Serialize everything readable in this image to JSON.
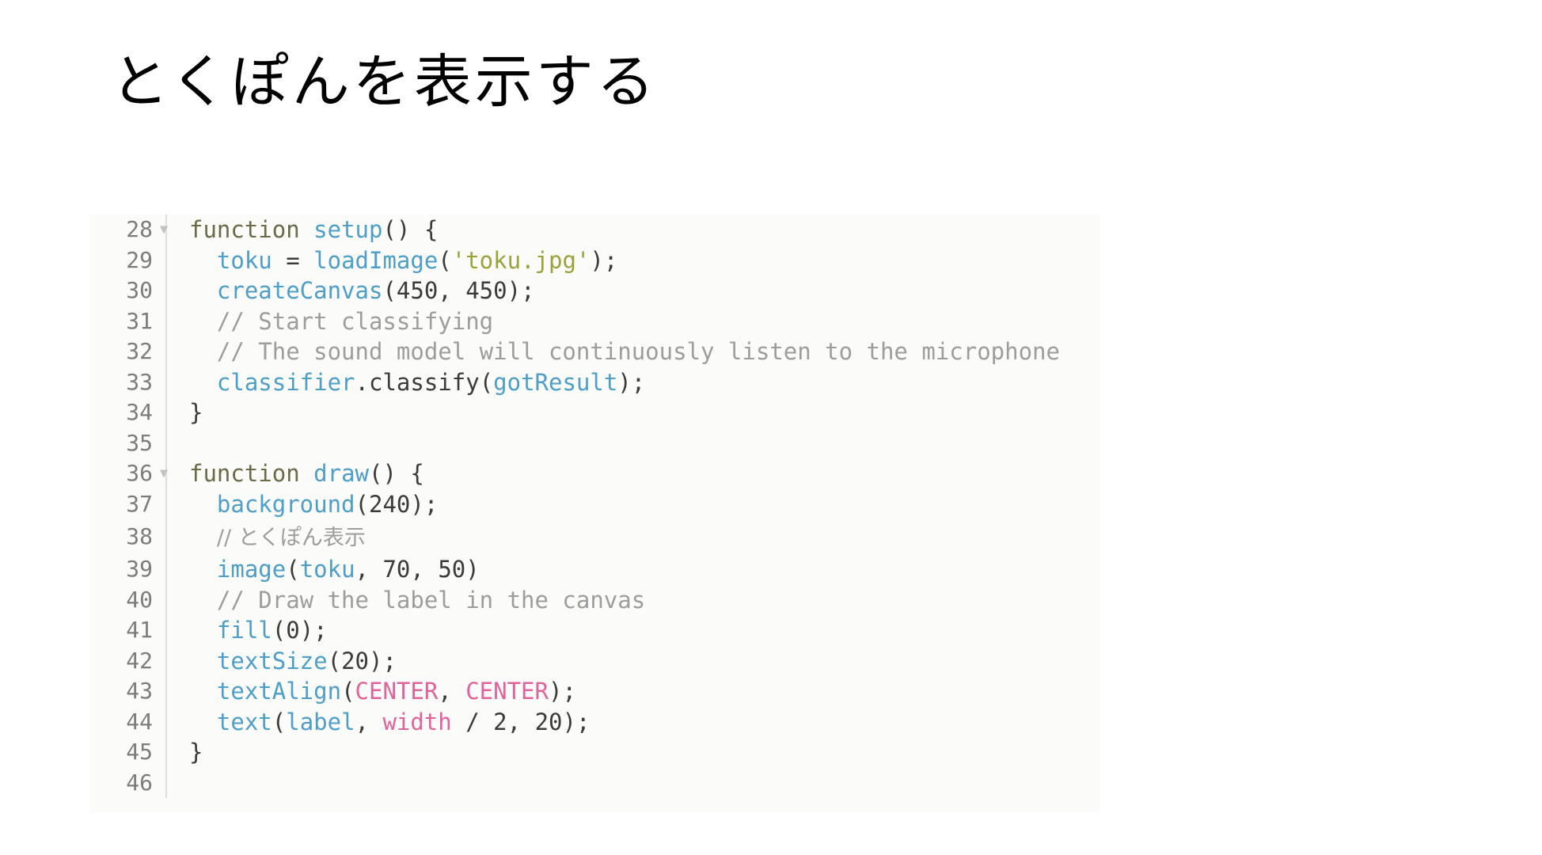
{
  "slide": {
    "title": "とくぽんを表示する",
    "background_color": "#ffffff",
    "title_color": "#000000"
  },
  "code_panel": {
    "background_color": "#fbfbfa",
    "gutter_color": "#7d7d7d",
    "language": "javascript",
    "fold_marker": "▼",
    "syntax_colors": {
      "keyword": "#6b6b47",
      "function": "#4d9ec9",
      "string": "#9aa33a",
      "comment": "#9d9d9d",
      "constant": "#e0649a",
      "plain": "#3b3b38"
    },
    "lines": [
      {
        "number": "28",
        "fold": "▼",
        "tokens": [
          {
            "t": "function",
            "c": "tok-kw"
          },
          {
            "t": " ",
            "c": "tok-plain"
          },
          {
            "t": "setup",
            "c": "tok-fn"
          },
          {
            "t": "() {",
            "c": "tok-punct"
          }
        ]
      },
      {
        "number": "29",
        "fold": "",
        "tokens": [
          {
            "t": "  ",
            "c": "tok-plain"
          },
          {
            "t": "toku",
            "c": "tok-var"
          },
          {
            "t": " = ",
            "c": "tok-punct"
          },
          {
            "t": "loadImage",
            "c": "tok-builtin"
          },
          {
            "t": "(",
            "c": "tok-punct"
          },
          {
            "t": "'toku.jpg'",
            "c": "tok-str"
          },
          {
            "t": ");",
            "c": "tok-punct"
          }
        ]
      },
      {
        "number": "30",
        "fold": "",
        "tokens": [
          {
            "t": "  ",
            "c": "tok-plain"
          },
          {
            "t": "createCanvas",
            "c": "tok-builtin"
          },
          {
            "t": "(",
            "c": "tok-punct"
          },
          {
            "t": "450",
            "c": "tok-num"
          },
          {
            "t": ", ",
            "c": "tok-punct"
          },
          {
            "t": "450",
            "c": "tok-num"
          },
          {
            "t": ");",
            "c": "tok-punct"
          }
        ]
      },
      {
        "number": "31",
        "fold": "",
        "tokens": [
          {
            "t": "  ",
            "c": "tok-plain"
          },
          {
            "t": "// Start classifying",
            "c": "tok-comment"
          }
        ]
      },
      {
        "number": "32",
        "fold": "",
        "tokens": [
          {
            "t": "  ",
            "c": "tok-plain"
          },
          {
            "t": "// The sound model will continuously listen to the microphone",
            "c": "tok-comment"
          }
        ]
      },
      {
        "number": "33",
        "fold": "",
        "tokens": [
          {
            "t": "  ",
            "c": "tok-plain"
          },
          {
            "t": "classifier",
            "c": "tok-var"
          },
          {
            "t": ".",
            "c": "tok-punct"
          },
          {
            "t": "classify",
            "c": "tok-plain"
          },
          {
            "t": "(",
            "c": "tok-punct"
          },
          {
            "t": "gotResult",
            "c": "tok-builtin"
          },
          {
            "t": ");",
            "c": "tok-punct"
          }
        ]
      },
      {
        "number": "34",
        "fold": "",
        "tokens": [
          {
            "t": "}",
            "c": "tok-punct"
          }
        ]
      },
      {
        "number": "35",
        "fold": "",
        "tokens": []
      },
      {
        "number": "36",
        "fold": "▼",
        "tokens": [
          {
            "t": "function",
            "c": "tok-kw"
          },
          {
            "t": " ",
            "c": "tok-plain"
          },
          {
            "t": "draw",
            "c": "tok-fn"
          },
          {
            "t": "() {",
            "c": "tok-punct"
          }
        ]
      },
      {
        "number": "37",
        "fold": "",
        "tokens": [
          {
            "t": "  ",
            "c": "tok-plain"
          },
          {
            "t": "background",
            "c": "tok-builtin"
          },
          {
            "t": "(",
            "c": "tok-punct"
          },
          {
            "t": "240",
            "c": "tok-num"
          },
          {
            "t": ");",
            "c": "tok-punct"
          }
        ]
      },
      {
        "number": "38",
        "fold": "",
        "jp": true,
        "tokens": [
          {
            "t": "  ",
            "c": "tok-plain"
          },
          {
            "t": "// とくぽん表示",
            "c": "tok-comment-jp"
          }
        ]
      },
      {
        "number": "39",
        "fold": "",
        "tokens": [
          {
            "t": "  ",
            "c": "tok-plain"
          },
          {
            "t": "image",
            "c": "tok-builtin"
          },
          {
            "t": "(",
            "c": "tok-punct"
          },
          {
            "t": "toku",
            "c": "tok-var"
          },
          {
            "t": ", ",
            "c": "tok-punct"
          },
          {
            "t": "70",
            "c": "tok-num"
          },
          {
            "t": ", ",
            "c": "tok-punct"
          },
          {
            "t": "50",
            "c": "tok-num"
          },
          {
            "t": ")",
            "c": "tok-punct"
          }
        ]
      },
      {
        "number": "40",
        "fold": "",
        "tokens": [
          {
            "t": "  ",
            "c": "tok-plain"
          },
          {
            "t": "// Draw the label in the canvas",
            "c": "tok-comment"
          }
        ]
      },
      {
        "number": "41",
        "fold": "",
        "tokens": [
          {
            "t": "  ",
            "c": "tok-plain"
          },
          {
            "t": "fill",
            "c": "tok-builtin"
          },
          {
            "t": "(",
            "c": "tok-punct"
          },
          {
            "t": "0",
            "c": "tok-num"
          },
          {
            "t": ");",
            "c": "tok-punct"
          }
        ]
      },
      {
        "number": "42",
        "fold": "",
        "tokens": [
          {
            "t": "  ",
            "c": "tok-plain"
          },
          {
            "t": "textSize",
            "c": "tok-builtin"
          },
          {
            "t": "(",
            "c": "tok-punct"
          },
          {
            "t": "20",
            "c": "tok-num"
          },
          {
            "t": ");",
            "c": "tok-punct"
          }
        ]
      },
      {
        "number": "43",
        "fold": "",
        "tokens": [
          {
            "t": "  ",
            "c": "tok-plain"
          },
          {
            "t": "textAlign",
            "c": "tok-builtin"
          },
          {
            "t": "(",
            "c": "tok-punct"
          },
          {
            "t": "CENTER",
            "c": "tok-const"
          },
          {
            "t": ", ",
            "c": "tok-punct"
          },
          {
            "t": "CENTER",
            "c": "tok-const"
          },
          {
            "t": ");",
            "c": "tok-punct"
          }
        ]
      },
      {
        "number": "44",
        "fold": "",
        "tokens": [
          {
            "t": "  ",
            "c": "tok-plain"
          },
          {
            "t": "text",
            "c": "tok-builtin"
          },
          {
            "t": "(",
            "c": "tok-punct"
          },
          {
            "t": "label",
            "c": "tok-var"
          },
          {
            "t": ", ",
            "c": "tok-punct"
          },
          {
            "t": "width",
            "c": "tok-const"
          },
          {
            "t": " / ",
            "c": "tok-punct"
          },
          {
            "t": "2",
            "c": "tok-num"
          },
          {
            "t": ", ",
            "c": "tok-punct"
          },
          {
            "t": "20",
            "c": "tok-num"
          },
          {
            "t": ");",
            "c": "tok-punct"
          }
        ]
      },
      {
        "number": "45",
        "fold": "",
        "tokens": [
          {
            "t": "}",
            "c": "tok-punct"
          }
        ]
      },
      {
        "number": "46",
        "fold": "",
        "tokens": []
      }
    ]
  }
}
